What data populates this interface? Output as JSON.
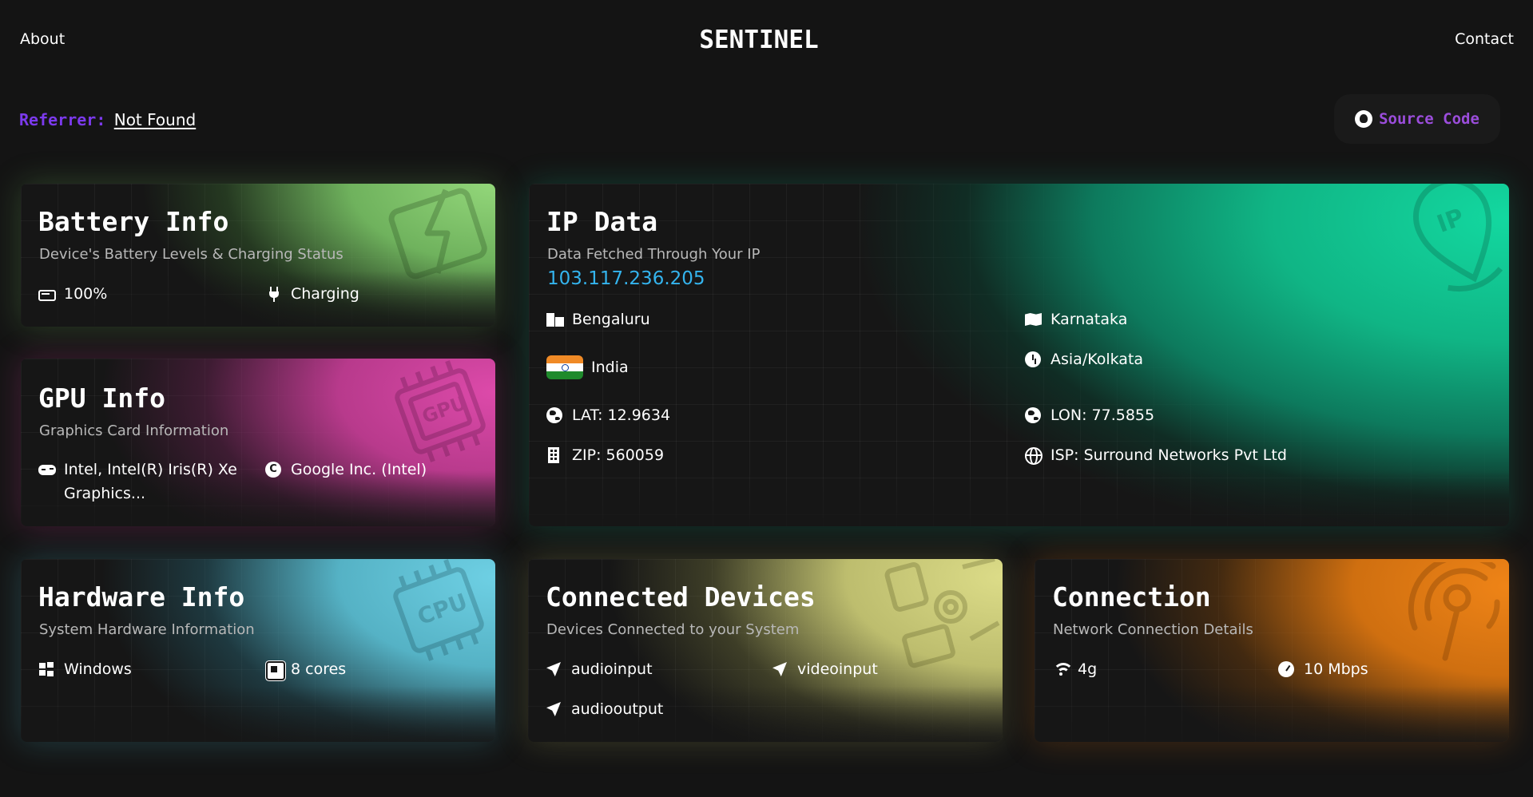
{
  "nav": {
    "about": "About",
    "brand": "SENTINEL",
    "contact": "Contact"
  },
  "referrer": {
    "label": "Referrer:",
    "value": "Not Found"
  },
  "source": {
    "label": "Source Code"
  },
  "battery": {
    "title": "Battery Info",
    "subtitle": "Device's Battery Levels & Charging Status",
    "level": "100%",
    "status": "Charging",
    "accent": "#93d77a"
  },
  "gpu": {
    "title": "GPU Info",
    "subtitle": "Graphics Card Information",
    "renderer": "Intel, Intel(R) Iris(R) Xe Graphics...",
    "vendor": "Google Inc. (Intel)",
    "accent": "#dd4aaa"
  },
  "ip": {
    "title": "IP Data",
    "subtitle": "Data Fetched Through Your IP",
    "address": "103.117.236.205",
    "city": "Bengaluru",
    "region": "Karnataka",
    "country": "India",
    "timezone": "Asia/Kolkata",
    "lat": "LAT: 12.9634",
    "lon": "LON: 77.5855",
    "zip": "ZIP: 560059",
    "isp": "ISP: Surround Networks Pvt Ltd",
    "accent": "#13d8a0"
  },
  "hardware": {
    "title": "Hardware Info",
    "subtitle": "System Hardware Information",
    "os": "Windows",
    "cores": "8 cores",
    "accent": "#6ed0e4"
  },
  "devices": {
    "title": "Connected Devices",
    "subtitle": "Devices Connected to your System",
    "items": [
      "audioinput",
      "videoinput",
      "audiooutput"
    ],
    "accent": "#dcdc88"
  },
  "connection": {
    "title": "Connection",
    "subtitle": "Network Connection Details",
    "type": "4g",
    "speed": "10 Mbps",
    "accent": "#ef8417"
  },
  "icons": {
    "battery": "battery-icon",
    "charging": "plug-icon",
    "gpu_renderer": "gamepad-icon",
    "gpu_vendor": "copyright-icon",
    "city": "city-icon",
    "region": "map-icon",
    "country": "india-flag-icon",
    "timezone": "clock-icon",
    "lat": "globe-icon",
    "lon": "globe-icon",
    "zip": "building-icon",
    "isp": "web-icon",
    "os": "windows-icon",
    "cores": "chip-icon",
    "device": "send-icon",
    "connection_type": "wifi-icon",
    "speed": "gauge-icon",
    "source": "github-icon"
  }
}
